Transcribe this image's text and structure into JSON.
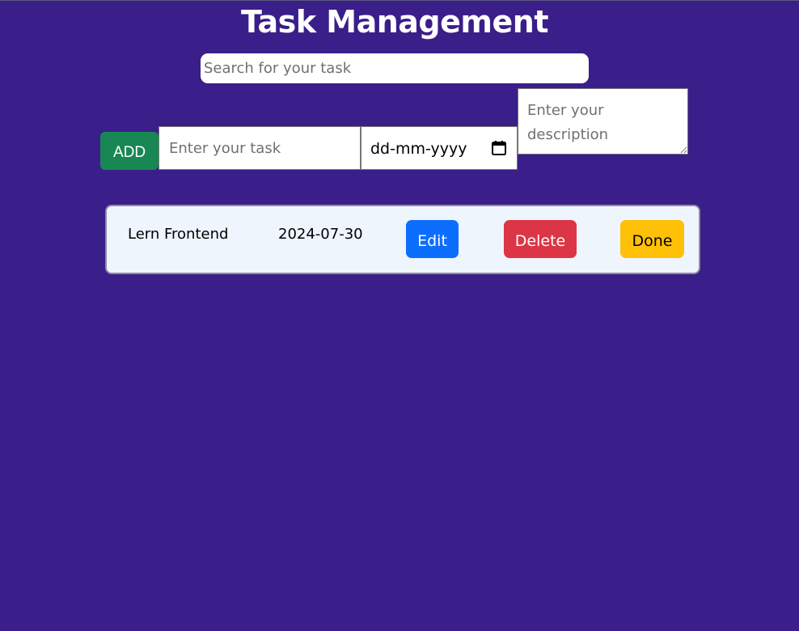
{
  "header": {
    "title": "Task Management"
  },
  "search": {
    "placeholder": "Search for your task",
    "value": ""
  },
  "form": {
    "add_label": "ADD",
    "task_placeholder": "Enter your task",
    "date_placeholder": "dd-mm-yyyy",
    "description_placeholder": "Enter your description"
  },
  "tasks": [
    {
      "name": "Lern Frontend",
      "date": "2024-07-30",
      "edit_label": "Edit",
      "delete_label": "Delete",
      "done_label": "Done"
    }
  ],
  "colors": {
    "background": "#3a1e8a",
    "add": "#198754",
    "edit": "#0d6efd",
    "delete": "#dc3545",
    "done": "#ffc107",
    "card": "#eef5fd"
  },
  "icons": {
    "date_picker": "calendar-icon"
  }
}
